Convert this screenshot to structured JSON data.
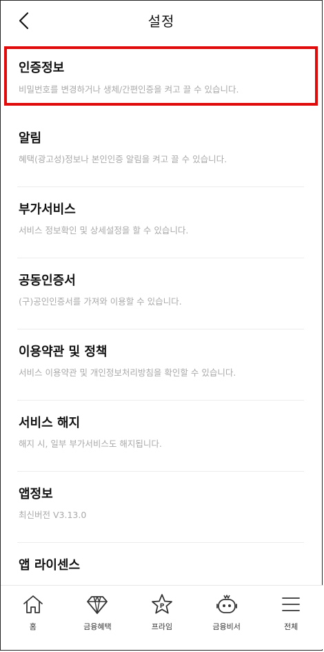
{
  "header": {
    "title": "설정"
  },
  "settings": [
    {
      "label": "인증정보",
      "description": "비밀번호를 변경하거나 생체/간편인증을 켜고 끌 수 있습니다."
    },
    {
      "label": "알림",
      "description": "혜택(광고성)정보나 본인인증 알림을 켜고 끌 수 있습니다."
    },
    {
      "label": "부가서비스",
      "description": "서비스 정보확인 및 상세설정을 할 수 있습니다."
    },
    {
      "label": "공동인증서",
      "description": "(구)공인인증서를 가져와 이용할 수 있습니다."
    },
    {
      "label": "이용약관 및 정책",
      "description": "서비스 이용약관 및 개인정보처리방침을 확인할 수 있습니다."
    },
    {
      "label": "서비스 해지",
      "description": "해지 시, 일부 부가서비스도 해지됩니다."
    },
    {
      "label": "앱정보",
      "description": "최신버전 V3.13.0"
    },
    {
      "label": "앱 라이센스",
      "description": ""
    }
  ],
  "bottom_nav": [
    {
      "label": "홈",
      "icon": "home-icon"
    },
    {
      "label": "금융혜택",
      "icon": "diamond-icon"
    },
    {
      "label": "프라임",
      "icon": "star-p-icon"
    },
    {
      "label": "금융비서",
      "icon": "robot-icon"
    },
    {
      "label": "전체",
      "icon": "menu-icon"
    }
  ],
  "colors": {
    "highlight": "#e10a0a",
    "description_text": "#a9a9a9",
    "divider": "#ececec"
  }
}
